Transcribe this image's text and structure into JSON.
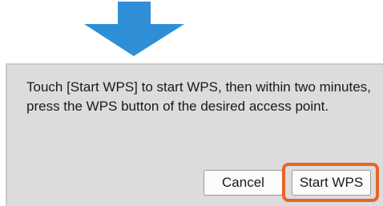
{
  "colors": {
    "arrow": "#2e8fd6",
    "dialog_background": "#dcdcdc",
    "highlight": "#e8642a"
  },
  "icons": {
    "arrow": "down-arrow-icon"
  },
  "dialog": {
    "message": "Touch [Start WPS] to start WPS, then within two minutes, press the WPS button of the desired access point.",
    "cancel_label": "Cancel",
    "start_label": "Start WPS"
  }
}
